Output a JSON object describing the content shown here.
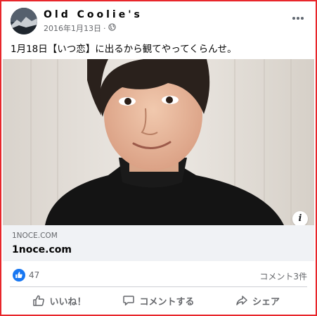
{
  "post": {
    "author": "Old Coolie's",
    "date": "2016年1月13日",
    "separator": "·",
    "privacy_icon": "globe-icon",
    "more_icon": "more-options-icon",
    "text": "1月18日【いつ恋】に出るから観てやってくらんせ。"
  },
  "link_preview": {
    "domain": "1NOCE.COM",
    "title": "1noce.com",
    "info_label": "i"
  },
  "stats": {
    "like_count": "47",
    "comment_count": "コメント3件"
  },
  "actions": {
    "like_label": "いいね！",
    "comment_label": "コメントする",
    "share_label": "シェア"
  },
  "colors": {
    "frame_border": "#e8262b",
    "like_blue": "#1877f2",
    "secondary_text": "#65676b",
    "link_bg": "#f0f2f5"
  }
}
